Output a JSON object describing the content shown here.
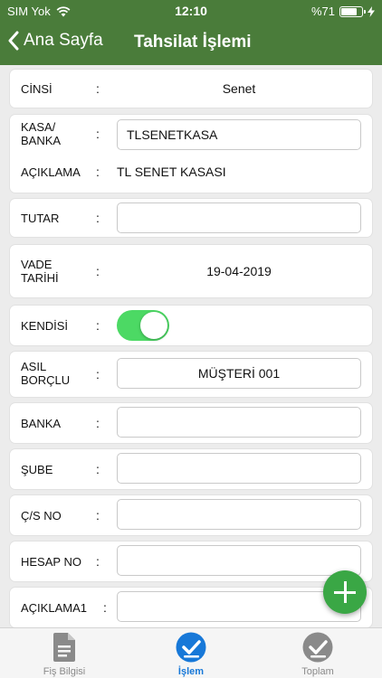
{
  "status_bar": {
    "carrier": "SIM Yok",
    "time": "12:10",
    "battery": "%71"
  },
  "nav": {
    "back_label": "Ana Sayfa",
    "title": "Tahsilat İşlemi"
  },
  "colon": ":",
  "form": {
    "cinsi": {
      "label": "CİNSİ",
      "value": "Senet"
    },
    "kasa_banka": {
      "label_line1": "KASA/",
      "label_line2": "BANKA",
      "value": "TLSENETKASA"
    },
    "aciklama": {
      "label": "AÇIKLAMA",
      "value": "TL SENET KASASI"
    },
    "tutar": {
      "label": "TUTAR",
      "value": ""
    },
    "vade_tarihi": {
      "label_line1": "VADE",
      "label_line2": "TARİHİ",
      "value": "19-04-2019"
    },
    "kendisi": {
      "label": "KENDİSİ",
      "enabled": true
    },
    "asil_borclu": {
      "label_line1": "ASIL",
      "label_line2": "BORÇLU",
      "value": "MÜŞTERİ 001"
    },
    "banka": {
      "label": "BANKA",
      "value": ""
    },
    "sube": {
      "label": "ŞUBE",
      "value": ""
    },
    "cs_no": {
      "label": "Ç/S NO",
      "value": ""
    },
    "hesap_no": {
      "label": "HESAP NO",
      "value": ""
    },
    "aciklama1": {
      "label": "AÇIKLAMA1",
      "value": ""
    }
  },
  "tabs": [
    {
      "label": "Fiş Bilgisi",
      "icon": "document-icon",
      "active": false
    },
    {
      "label": "İşlem",
      "icon": "check-circle-icon",
      "active": true
    },
    {
      "label": "Toplam",
      "icon": "check-circle-icon",
      "active": false
    }
  ],
  "colors": {
    "header": "#4a7c3a",
    "accent": "#1778d8",
    "toggle_on": "#4cd964",
    "fab": "#3aa745",
    "tab_inactive": "#8a8a8a"
  }
}
